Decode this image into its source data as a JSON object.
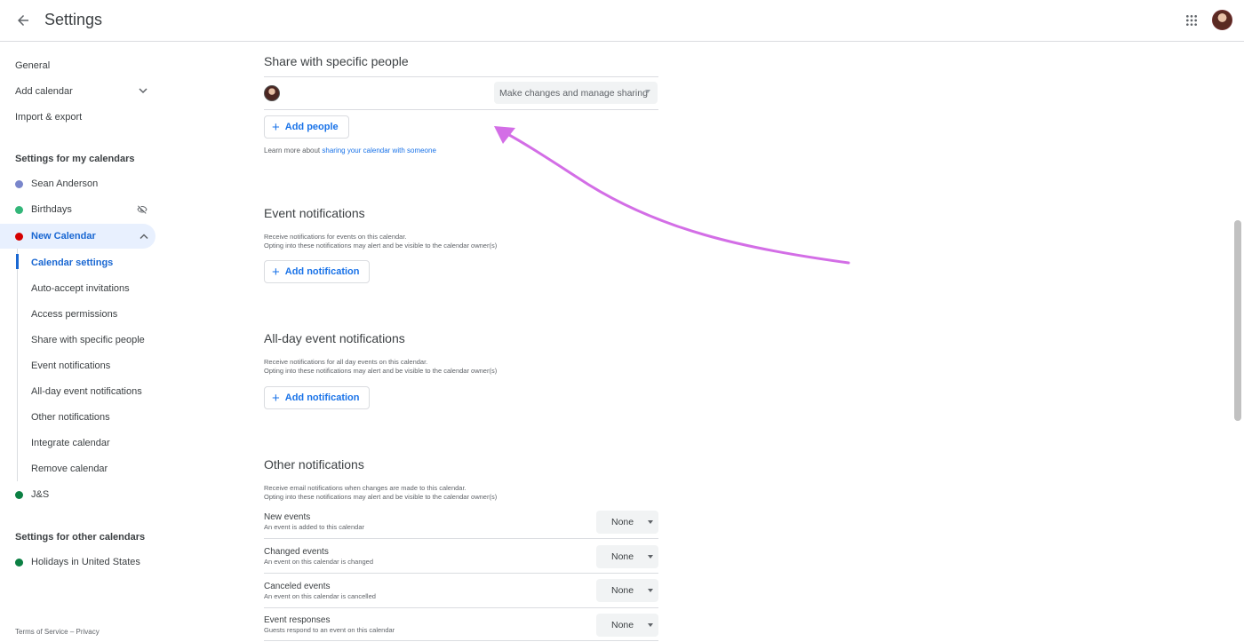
{
  "header": {
    "title": "Settings"
  },
  "sidebar": {
    "top_items": [
      {
        "label": "General"
      },
      {
        "label": "Add calendar"
      },
      {
        "label": "Import & export"
      }
    ],
    "my_calendars_heading": "Settings for my calendars",
    "my_calendars": [
      {
        "label": "Sean Anderson",
        "color": "#7986cb"
      },
      {
        "label": "Birthdays",
        "color": "#33b679"
      },
      {
        "label": "New Calendar",
        "color": "#d50000"
      }
    ],
    "sub_items": [
      {
        "label": "Calendar settings"
      },
      {
        "label": "Auto-accept invitations"
      },
      {
        "label": "Access permissions"
      },
      {
        "label": "Share with specific people"
      },
      {
        "label": "Event notifications"
      },
      {
        "label": "All-day event notifications"
      },
      {
        "label": "Other notifications"
      },
      {
        "label": "Integrate calendar"
      },
      {
        "label": "Remove calendar"
      }
    ],
    "js_calendar": {
      "label": "J&S",
      "color": "#0b8043"
    },
    "other_calendars_heading": "Settings for other calendars",
    "other_calendars": [
      {
        "label": "Holidays in United States",
        "color": "#0b8043"
      }
    ],
    "footer": {
      "terms": "Terms of Service",
      "separator": "–",
      "privacy": "Privacy"
    }
  },
  "share": {
    "heading": "Share with specific people",
    "permission": "Make changes and manage sharing",
    "add_people": "Add people",
    "learn_prefix": "Learn more about",
    "learn_link": "sharing your calendar with someone"
  },
  "event_notifications": {
    "heading": "Event notifications",
    "desc1": "Receive notifications for events on this calendar.",
    "desc2": "Opting into these notifications may alert and be visible to the calendar owner(s)",
    "add": "Add notification"
  },
  "allday_notifications": {
    "heading": "All-day event notifications",
    "desc1": "Receive notifications for all day events on this calendar.",
    "desc2": "Opting into these notifications may alert and be visible to the calendar owner(s)",
    "add": "Add notification"
  },
  "other_notifications": {
    "heading": "Other notifications",
    "desc1": "Receive email notifications when changes are made to this calendar.",
    "desc2": "Opting into these notifications may alert and be visible to the calendar owner(s)",
    "rows": [
      {
        "title": "New events",
        "sub": "An event is added to this calendar",
        "value": "None"
      },
      {
        "title": "Changed events",
        "sub": "An event on this calendar is changed",
        "value": "None"
      },
      {
        "title": "Canceled events",
        "sub": "An event on this calendar is cancelled",
        "value": "None"
      },
      {
        "title": "Event responses",
        "sub": "Guests respond to an event on this calendar",
        "value": "None"
      }
    ]
  },
  "colors": {
    "accent": "#1a73e8",
    "annotation_arrow": "#d36ee6"
  }
}
